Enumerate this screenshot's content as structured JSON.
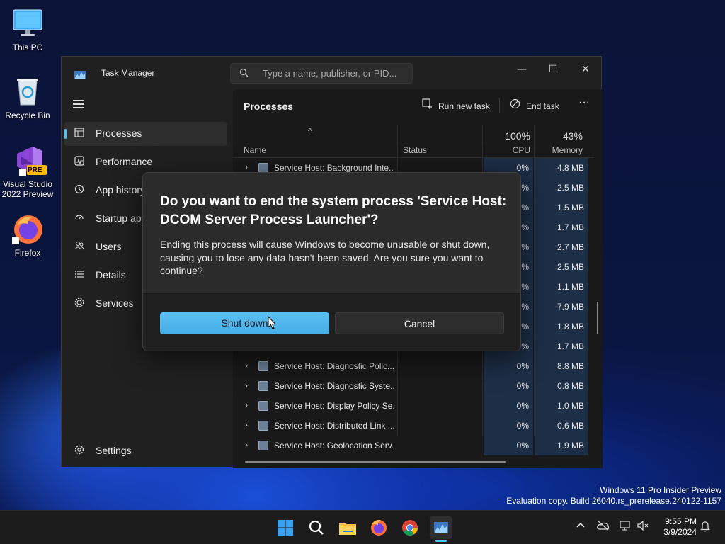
{
  "desktop": {
    "icons": [
      {
        "label": "This PC"
      },
      {
        "label": "Recycle Bin"
      },
      {
        "label": "Visual Studio 2022 Preview",
        "badge": "PRE"
      },
      {
        "label": "Firefox"
      }
    ]
  },
  "task_manager": {
    "title": "Task Manager",
    "search_placeholder": "Type a name, publisher, or PID...",
    "window_buttons": {
      "minimize": "—",
      "maximize": "☐",
      "close": "✕"
    },
    "nav": [
      {
        "label": "Processes",
        "icon": "processes-icon"
      },
      {
        "label": "Performance",
        "icon": "performance-icon"
      },
      {
        "label": "App history",
        "icon": "app-history-icon"
      },
      {
        "label": "Startup apps",
        "icon": "startup-icon"
      },
      {
        "label": "Users",
        "icon": "users-icon"
      },
      {
        "label": "Details",
        "icon": "details-icon"
      },
      {
        "label": "Services",
        "icon": "services-icon"
      }
    ],
    "settings_label": "Settings",
    "main": {
      "title": "Processes",
      "run_new_task": "Run new task",
      "end_task": "End task",
      "more": "···",
      "columns": {
        "name": "Name",
        "status": "Status",
        "cpu_pct": "100%",
        "cpu": "CPU",
        "mem_pct": "43%",
        "memory": "Memory"
      },
      "rows": [
        {
          "name": "Service Host: Background Inte...",
          "cpu": "0%",
          "mem": "4.8 MB"
        },
        {
          "name": "",
          "cpu": "0%",
          "mem": "2.5 MB"
        },
        {
          "name": "",
          "cpu": "0%",
          "mem": "1.5 MB"
        },
        {
          "name": "",
          "cpu": "0%",
          "mem": "1.7 MB"
        },
        {
          "name": "",
          "cpu": "0%",
          "mem": "2.7 MB"
        },
        {
          "name": "",
          "cpu": "0%",
          "mem": "2.5 MB"
        },
        {
          "name": "",
          "cpu": "0%",
          "mem": "1.1 MB"
        },
        {
          "name": "",
          "cpu": "0%",
          "mem": "7.9 MB"
        },
        {
          "name": "",
          "cpu": "0%",
          "mem": "1.8 MB"
        },
        {
          "name": "",
          "cpu": "0%",
          "mem": "1.7 MB"
        },
        {
          "name": "Service Host: Diagnostic Polic...",
          "cpu": "0%",
          "mem": "8.8 MB"
        },
        {
          "name": "Service Host: Diagnostic Syste...",
          "cpu": "0%",
          "mem": "0.8 MB"
        },
        {
          "name": "Service Host: Display Policy Se...",
          "cpu": "0%",
          "mem": "1.0 MB"
        },
        {
          "name": "Service Host: Distributed Link ...",
          "cpu": "0%",
          "mem": "0.6 MB"
        },
        {
          "name": "Service Host: Geolocation Serv...",
          "cpu": "0%",
          "mem": "1.9 MB"
        }
      ]
    }
  },
  "dialog": {
    "title": "Do you want to end the system process 'Service Host: DCOM Server Process Launcher'?",
    "message": "Ending this process will cause Windows to become unusable or shut down, causing you to lose any data hasn't been saved. Are you sure you want to continue?",
    "primary_button": "Shut down",
    "secondary_button": "Cancel"
  },
  "watermark": {
    "line1": "Windows 11 Pro Insider Preview",
    "line2": "Evaluation copy. Build 26040.rs_prerelease.240122-1157"
  },
  "taskbar": {
    "time": "9:55 PM",
    "date": "3/9/2024",
    "apps": [
      "start-icon",
      "search-icon",
      "file-explorer-icon",
      "firefox-icon",
      "chrome-icon",
      "task-manager-icon"
    ]
  },
  "colors": {
    "accent": "#4cc2ff",
    "cpu_highlight": "#1d2e47",
    "window_bg": "#202020"
  }
}
